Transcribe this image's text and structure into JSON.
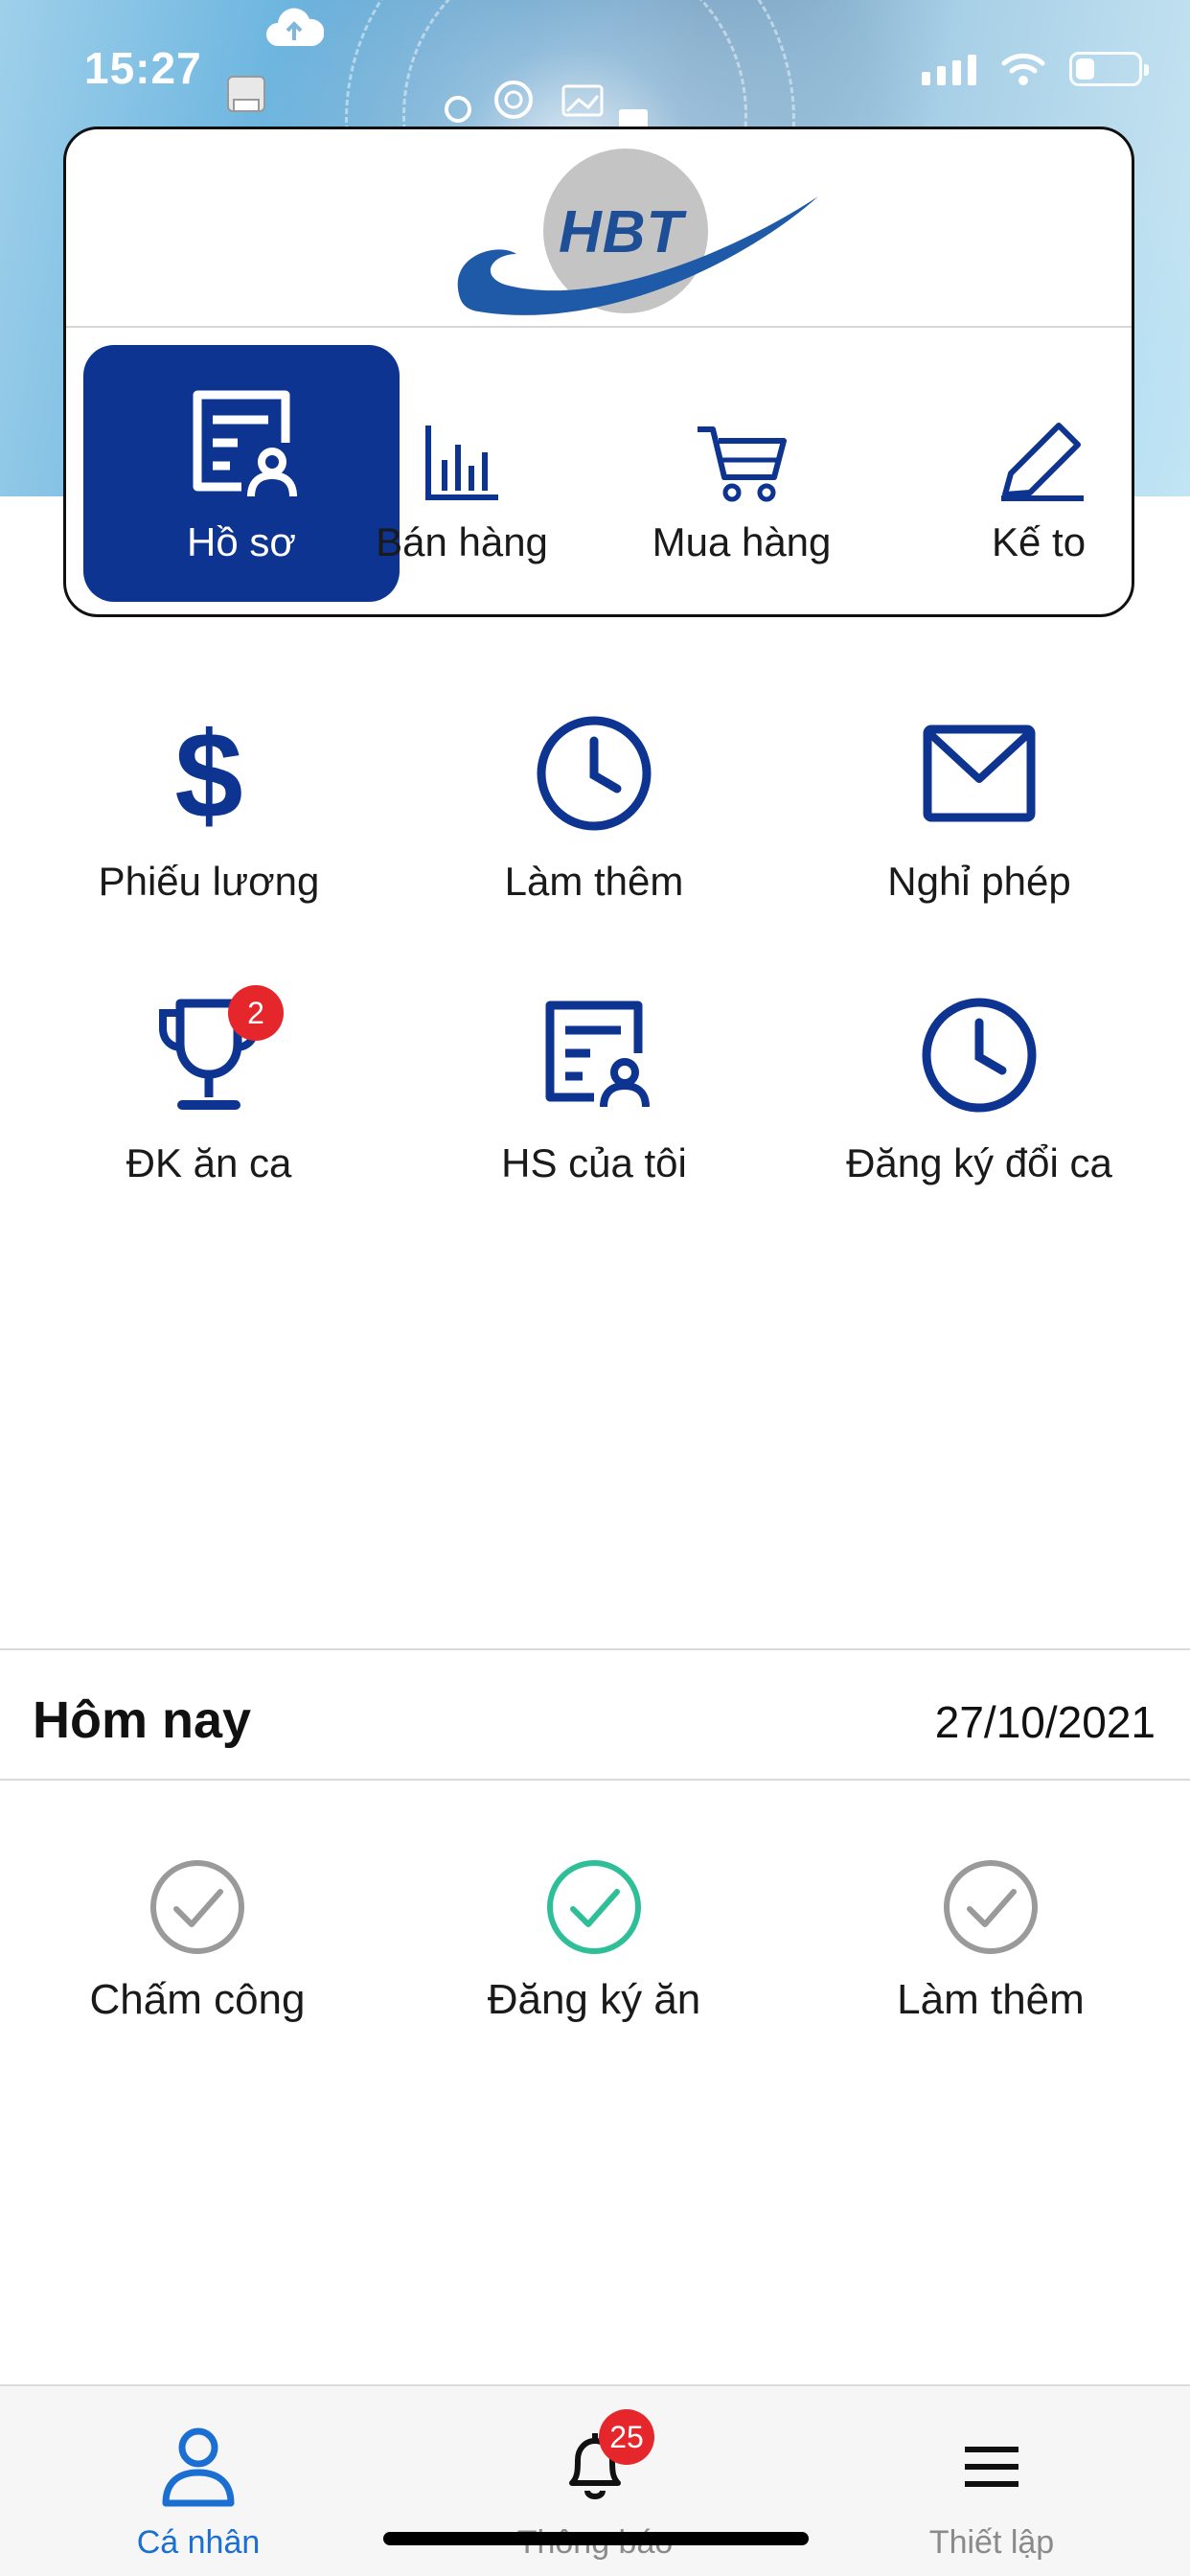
{
  "status_bar": {
    "time": "15:27",
    "battery_level": 0.3
  },
  "colors": {
    "brand_navy": "#0e3491",
    "badge_red": "#e5262b",
    "check_grey": "#9a9a9a",
    "check_green": "#2fbf98",
    "tab_active": "#1b6fd3"
  },
  "logo": {
    "text": "HBT"
  },
  "modules": [
    {
      "label": "Hồ sơ",
      "icon": "profile-document-icon",
      "active": true
    },
    {
      "label": "Bán hàng",
      "icon": "bar-chart-icon",
      "active": false
    },
    {
      "label": "Mua hàng",
      "icon": "shopping-cart-icon",
      "active": false
    },
    {
      "label": "Kế to",
      "icon": "pen-icon",
      "active": false
    }
  ],
  "features": [
    {
      "label": "Phiếu lương",
      "icon": "dollar-icon"
    },
    {
      "label": "Làm thêm",
      "icon": "clock-icon"
    },
    {
      "label": "Nghỉ phép",
      "icon": "envelope-icon"
    },
    {
      "label": "ĐK ăn ca",
      "icon": "trophy-icon",
      "badge": "2"
    },
    {
      "label": "HS của tôi",
      "icon": "profile-document-icon"
    },
    {
      "label": "Đăng ký đổi ca",
      "icon": "clock-icon"
    }
  ],
  "today": {
    "title": "Hôm nay",
    "date": "27/10/2021",
    "items": [
      {
        "label": "Chấm công",
        "icon": "check-circle-icon",
        "done": false
      },
      {
        "label": "Đăng ký ăn",
        "icon": "check-circle-icon",
        "done": true
      },
      {
        "label": "Làm thêm",
        "icon": "check-circle-icon",
        "done": false
      }
    ]
  },
  "tabbar": [
    {
      "label": "Cá nhân",
      "icon": "person-icon",
      "active": true
    },
    {
      "label": "Thông báo",
      "icon": "bell-icon",
      "badge": "25",
      "active": false
    },
    {
      "label": "Thiết lập",
      "icon": "menu-icon",
      "active": false
    }
  ]
}
